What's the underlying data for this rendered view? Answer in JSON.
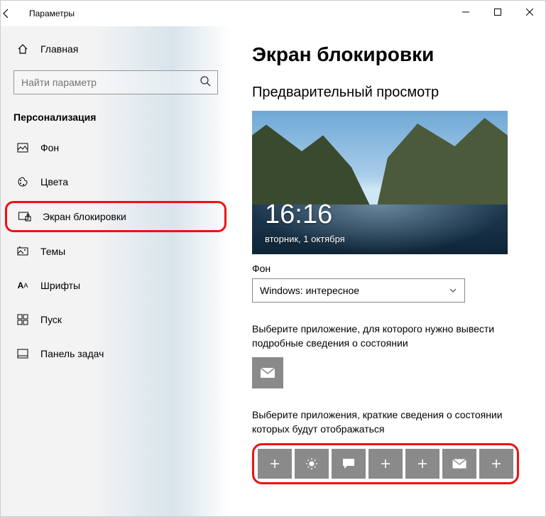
{
  "titlebar": {
    "title": "Параметры"
  },
  "sidebar": {
    "home": "Главная",
    "search_placeholder": "Найти параметр",
    "section": "Персонализация",
    "items": [
      {
        "label": "Фон"
      },
      {
        "label": "Цвета"
      },
      {
        "label": "Экран блокировки"
      },
      {
        "label": "Темы"
      },
      {
        "label": "Шрифты"
      },
      {
        "label": "Пуск"
      },
      {
        "label": "Панель задач"
      }
    ]
  },
  "main": {
    "heading": "Экран блокировки",
    "preview_label": "Предварительный просмотр",
    "clock": "16:16",
    "date": "вторник, 1 октября",
    "bg_label": "Фон",
    "bg_value": "Windows: интересное",
    "detail_desc": "Выберите приложение, для которого нужно вывести подробные сведения о состоянии",
    "quick_desc": "Выберите приложения, краткие сведения о состоянии которых будут отображаться"
  }
}
